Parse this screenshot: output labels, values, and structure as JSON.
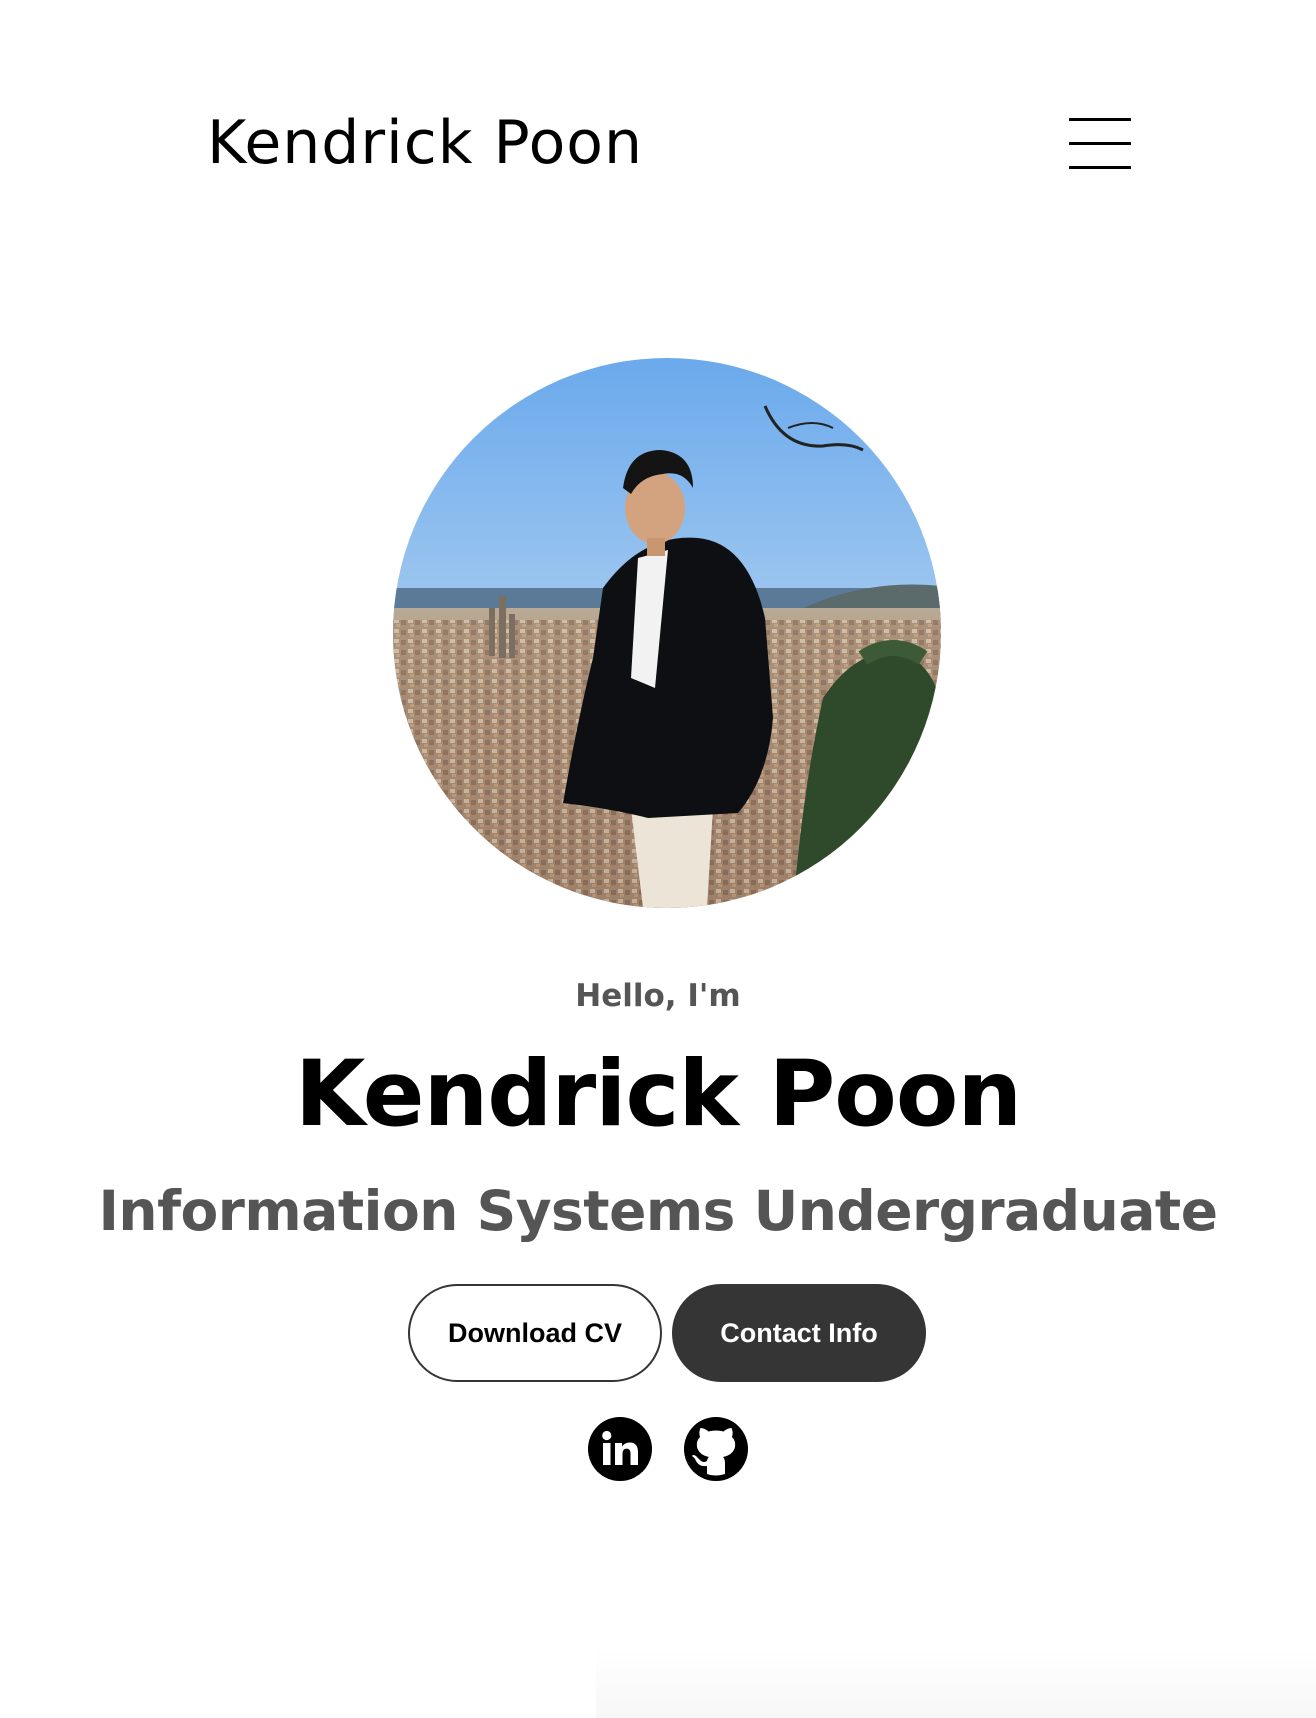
{
  "header": {
    "logo_text": "Kendrick Poon",
    "menu_icon": "hamburger-menu-icon"
  },
  "profile": {
    "photo_alt": "Portrait overlooking city",
    "greeting": "Hello, I'm",
    "name": "Kendrick Poon",
    "title": "Information Systems Undergraduate"
  },
  "actions": {
    "download_cv_label": "Download CV",
    "contact_info_label": "Contact Info"
  },
  "social": [
    {
      "icon": "linkedin-icon"
    },
    {
      "icon": "github-icon"
    }
  ],
  "colors": {
    "text_primary": "#000000",
    "text_secondary": "#555555",
    "button_dark": "#353535",
    "background": "#ffffff"
  }
}
